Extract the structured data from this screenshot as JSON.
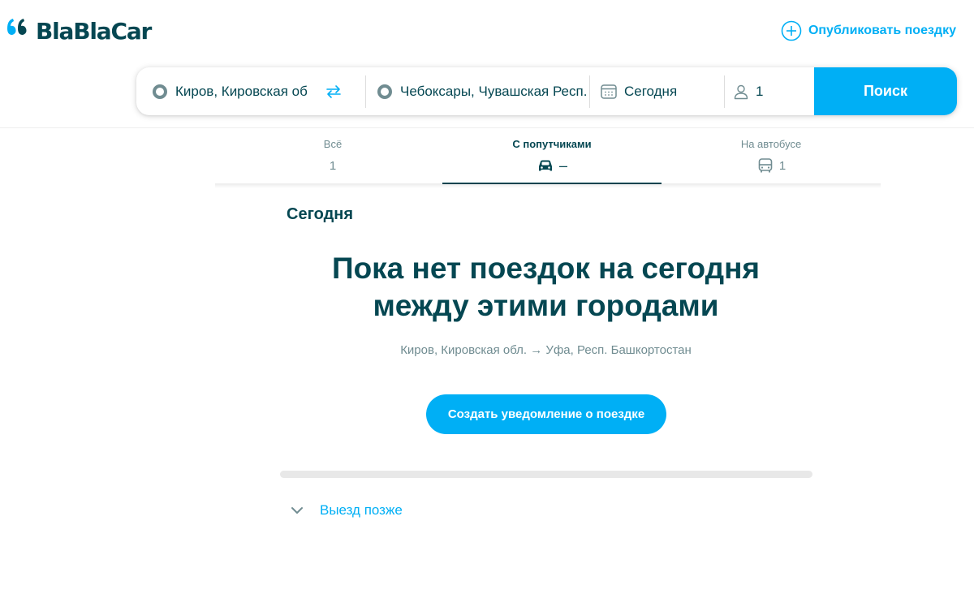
{
  "header": {
    "logo_text": "BlaBlaCar",
    "publish_label": "Опубликовать поездку"
  },
  "search": {
    "from_value": "Киров, Кировская обл.",
    "to_value": "Чебоксары, Чувашская Респ.",
    "date_value": "Сегодня",
    "passengers_value": "1",
    "button_label": "Поиск"
  },
  "tabs": [
    {
      "label": "Всё",
      "count": "1",
      "icon": "none"
    },
    {
      "label": "С попутчиками",
      "count": "–",
      "icon": "car-icon",
      "active": true
    },
    {
      "label": "На автобусе",
      "count": "1",
      "icon": "bus-icon"
    }
  ],
  "main": {
    "day_heading": "Сегодня",
    "empty_title_line1": "Пока нет поездок на сегодня",
    "empty_title_line2": "между этими городами",
    "route_text": "Киров, Кировская обл. → Уфа, Респ. Башкортостан",
    "notify_button": "Создать уведомление о поездке",
    "later_label": "Выезд позже"
  },
  "colors": {
    "primary_text": "#054752",
    "accent": "#00aff5",
    "secondary_text": "#708c91"
  }
}
